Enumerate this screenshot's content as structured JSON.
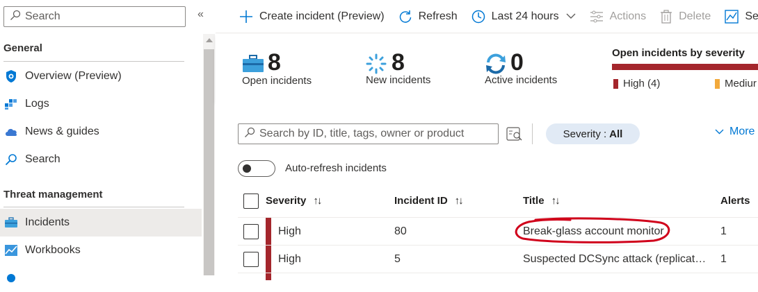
{
  "sidebar": {
    "search_placeholder": "Search",
    "collapse_glyph": "«",
    "sections": [
      {
        "title": "General"
      },
      {
        "title": "Threat management"
      }
    ],
    "items": [
      {
        "label": "Overview (Preview)",
        "icon": "shield-icon"
      },
      {
        "label": "Logs",
        "icon": "logs-icon"
      },
      {
        "label": "News & guides",
        "icon": "cloud-icon"
      },
      {
        "label": "Search",
        "icon": "search-icon"
      },
      {
        "label": "Incidents",
        "icon": "briefcase-icon",
        "active": true
      },
      {
        "label": "Workbooks",
        "icon": "workbooks-icon"
      }
    ]
  },
  "toolbar": {
    "create_label": "Create incident (Preview)",
    "refresh_label": "Refresh",
    "time_label": "Last 24 hours",
    "actions_label": "Actions",
    "delete_label": "Delete",
    "extra_label": "Se"
  },
  "metrics": {
    "open": {
      "value": "8",
      "label": "Open incidents"
    },
    "new": {
      "value": "8",
      "label": "New incidents"
    },
    "active": {
      "value": "0",
      "label": "Active incidents"
    },
    "severity_title": "Open incidents by severity",
    "severity_legend": [
      {
        "label": "High (4)",
        "color": "#a4262c"
      },
      {
        "label": "Mediur",
        "color": "#f2a93b"
      }
    ]
  },
  "filters": {
    "search_placeholder": "Search by ID, title, tags, owner or product",
    "severity_key": "Severity :",
    "severity_value": "All",
    "more_label": "More",
    "auto_refresh_label": "Auto-refresh incidents"
  },
  "table": {
    "headers": {
      "severity": "Severity",
      "incident_id": "Incident ID",
      "title": "Title",
      "alerts": "Alerts"
    },
    "rows": [
      {
        "severity": "High",
        "incident_id": "80",
        "title": "Break-glass account monitor",
        "alerts": "1"
      },
      {
        "severity": "High",
        "incident_id": "5",
        "title": "Suspected DCSync attack (replicat…",
        "alerts": "1"
      }
    ]
  },
  "colors": {
    "accent": "#0078d4",
    "high": "#a4262c",
    "annotation": "#d0021b"
  }
}
